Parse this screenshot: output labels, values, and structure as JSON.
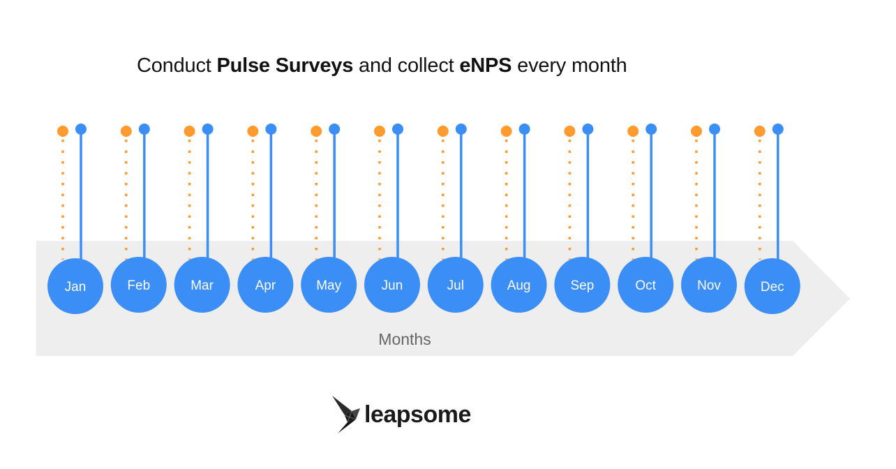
{
  "title": {
    "parts": [
      {
        "text": "Conduct ",
        "bold": false
      },
      {
        "text": "Pulse Surveys",
        "bold": true
      },
      {
        "text": " and collect ",
        "bold": false
      },
      {
        "text": "eNPS",
        "bold": true
      },
      {
        "text": " every month",
        "bold": false
      }
    ]
  },
  "timeline": {
    "axis_label": "Months",
    "months": [
      "Jan",
      "Feb",
      "Mar",
      "Apr",
      "May",
      "Jun",
      "Jul",
      "Aug",
      "Sep",
      "Oct",
      "Nov",
      "Dec"
    ],
    "markers": [
      {
        "name": "pulse-survey",
        "style": "dotted",
        "color": "#FF9A2E"
      },
      {
        "name": "enps",
        "style": "solid",
        "color": "#3A8EF6"
      }
    ]
  },
  "colors": {
    "circle": "#3A8EF6",
    "arrow": "#EEEEEE",
    "orange": "#FF9A2E",
    "blue": "#3A8EF6"
  },
  "logo": {
    "text": "leapsome",
    "icon": "bird-origami-icon"
  }
}
